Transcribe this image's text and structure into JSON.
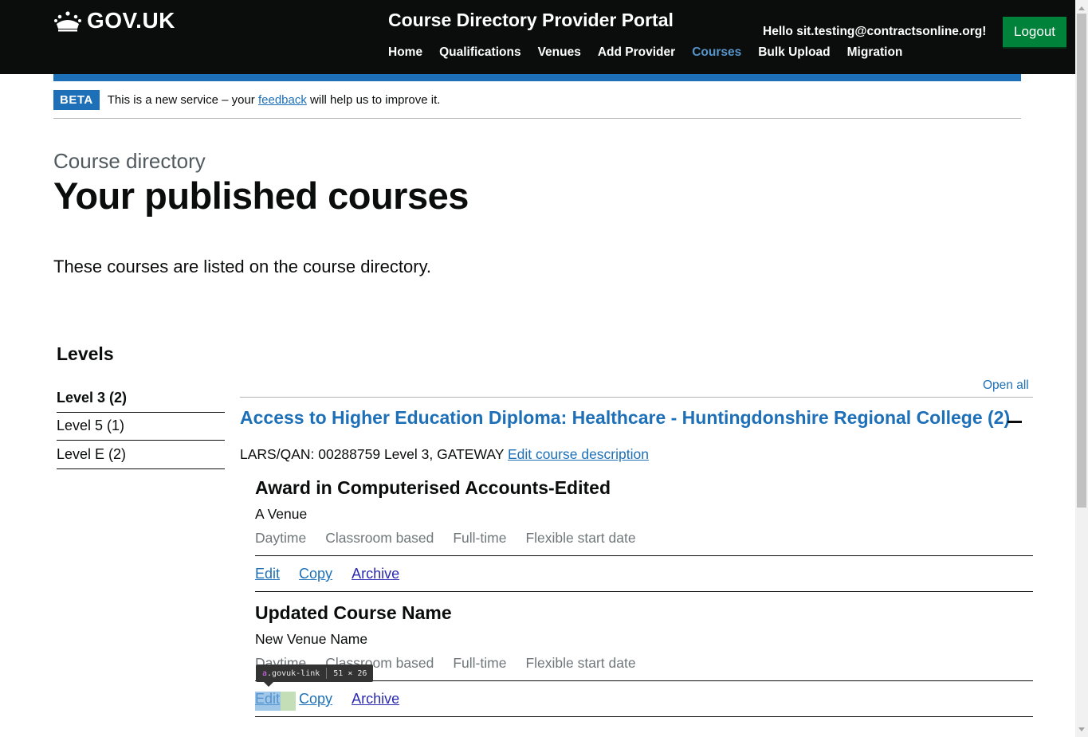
{
  "header": {
    "logo_text": "GOV.UK",
    "service_name": "Course Directory Provider Portal",
    "nav": [
      "Home",
      "Qualifications",
      "Venues",
      "Add Provider",
      "Courses",
      "Bulk Upload",
      "Migration"
    ],
    "active_nav": "Courses",
    "greeting": "Hello sit.testing@contractsonline.org!",
    "logout_label": "Logout"
  },
  "beta": {
    "tag": "BETA",
    "text_before": "This is a new service – your",
    "link": "feedback",
    "text_after": "will help us to improve it."
  },
  "page": {
    "caption": "Course directory",
    "title": "Your published courses",
    "lead": "These courses are listed on the course directory."
  },
  "filters": {
    "heading": "Levels",
    "items": [
      "Level 3 (2)",
      "Level 5 (1)",
      "Level E (2)"
    ]
  },
  "accordion": {
    "open_all": "Open all",
    "title": "Access to Higher Education Diploma: Healthcare - Huntingdonshire Regional College (2)",
    "lars": "LARS/QAN: 00288759 Level 3, GATEWAY",
    "edit_description": "Edit course description"
  },
  "courses": [
    {
      "name": "Award in Computerised Accounts-Edited",
      "venue": "A Venue",
      "attributes": [
        "Daytime",
        "Classroom based",
        "Full-time",
        "Flexible start date"
      ],
      "actions": [
        "Edit",
        "Copy",
        "Archive"
      ]
    },
    {
      "name": "Updated Course Name",
      "venue": "New Venue Name",
      "attributes": [
        "Daytime",
        "Classroom based",
        "Full-time",
        "Flexible start date"
      ],
      "actions": [
        "Edit",
        "Copy",
        "Archive"
      ]
    }
  ],
  "devtools_tooltip": {
    "tag": "a",
    "class": ".govuk-link",
    "size": "51 × 26"
  },
  "colors": {
    "header_bg": "#0b0c0c",
    "brand_blue": "#1d70b8",
    "logout_green": "#00823b",
    "active_nav": "#5694ca"
  }
}
